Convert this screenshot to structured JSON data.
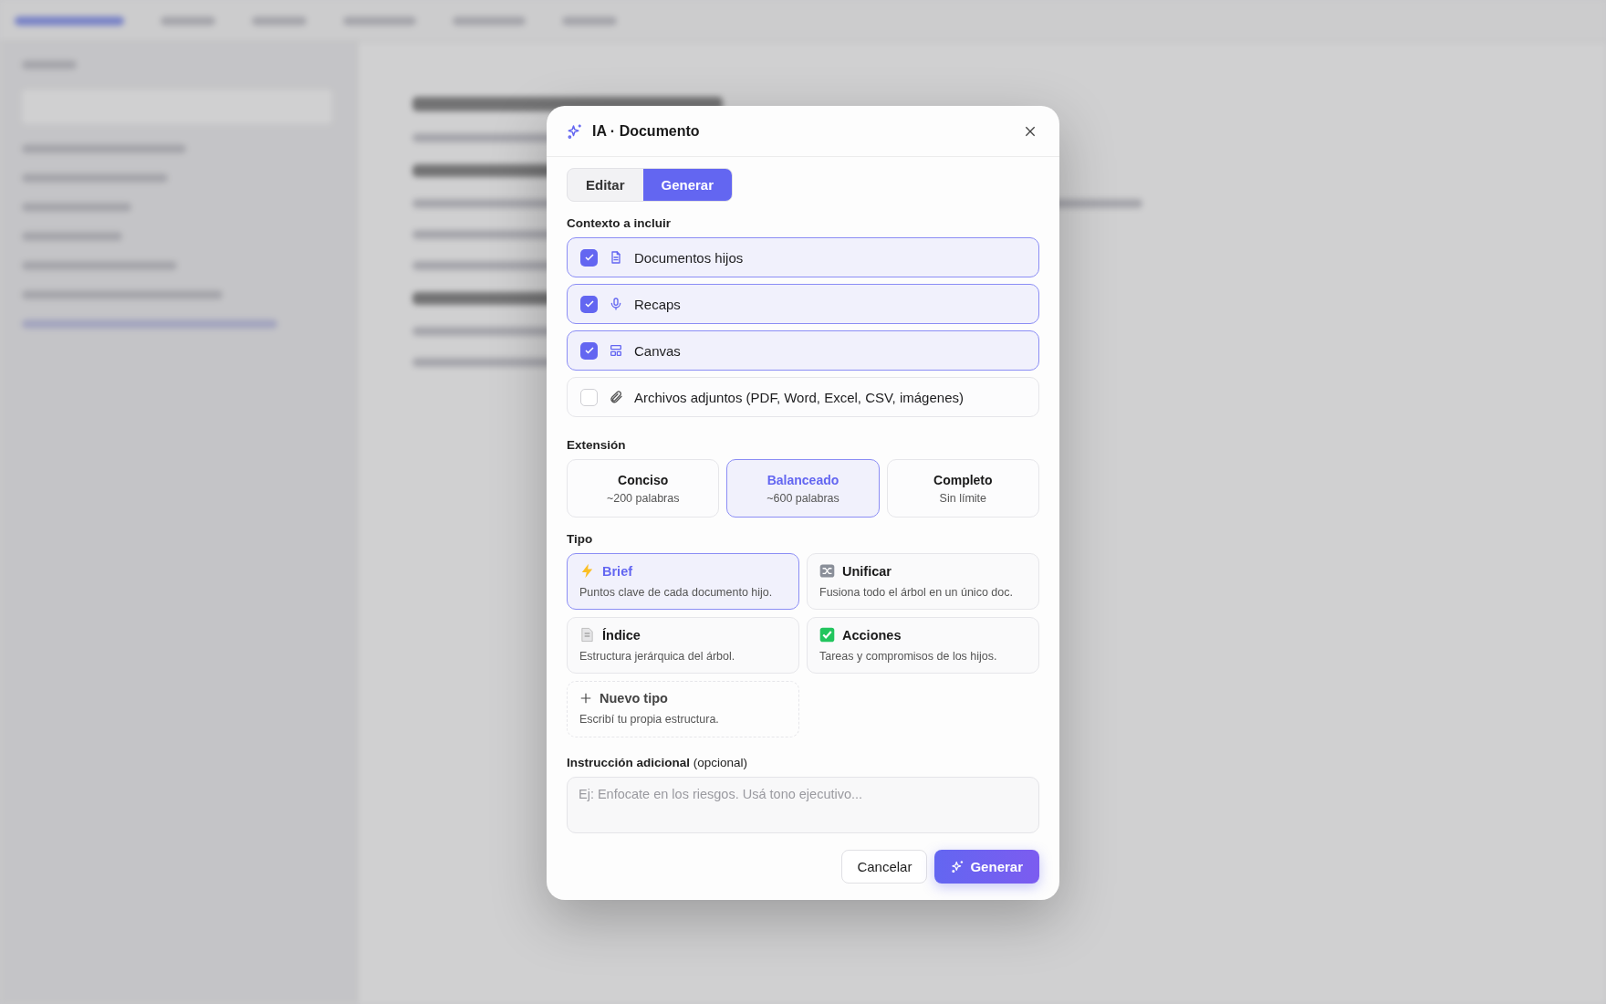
{
  "dialog": {
    "title": "IA · Documento",
    "tabs": [
      {
        "label": "Editar",
        "selected": false
      },
      {
        "label": "Generar",
        "selected": true
      }
    ],
    "context": {
      "label": "Contexto a incluir",
      "items": [
        {
          "kind": "documents",
          "label": "Documentos hijos",
          "checked": true
        },
        {
          "kind": "recaps",
          "label": "Recaps",
          "checked": true
        },
        {
          "kind": "canvas",
          "label": "Canvas",
          "checked": true
        },
        {
          "kind": "attachments",
          "label": "Archivos adjuntos (PDF, Word, Excel, CSV, imágenes)",
          "checked": false
        }
      ]
    },
    "length": {
      "label": "Extensión",
      "options": [
        {
          "title": "Conciso",
          "subtitle": "~200 palabras",
          "selected": false
        },
        {
          "title": "Balanceado",
          "subtitle": "~600 palabras",
          "selected": true
        },
        {
          "title": "Completo",
          "subtitle": "Sin límite",
          "selected": false
        }
      ]
    },
    "type": {
      "label": "Tipo",
      "options": [
        {
          "kind": "brief",
          "title": "Brief",
          "description": "Puntos clave de cada documento hijo.",
          "selected": true
        },
        {
          "kind": "merge",
          "title": "Unificar",
          "description": "Fusiona todo el árbol en un único doc.",
          "selected": false
        },
        {
          "kind": "index",
          "title": "Índice",
          "description": "Estructura jerárquica del árbol.",
          "selected": false
        },
        {
          "kind": "actions",
          "title": "Acciones",
          "description": "Tareas y compromisos de los hijos.",
          "selected": false
        },
        {
          "kind": "new",
          "title": "Nuevo tipo",
          "description": "Escribí tu propia estructura.",
          "selected": false
        }
      ]
    },
    "instruction": {
      "label": "**Instrucción adicional** (opcional)",
      "placeholder": "Ej: Enfocate en los riesgos. Usá tono ejecutivo..."
    },
    "buttons": {
      "cancel": "Cancelar",
      "submit": "Generar"
    }
  }
}
